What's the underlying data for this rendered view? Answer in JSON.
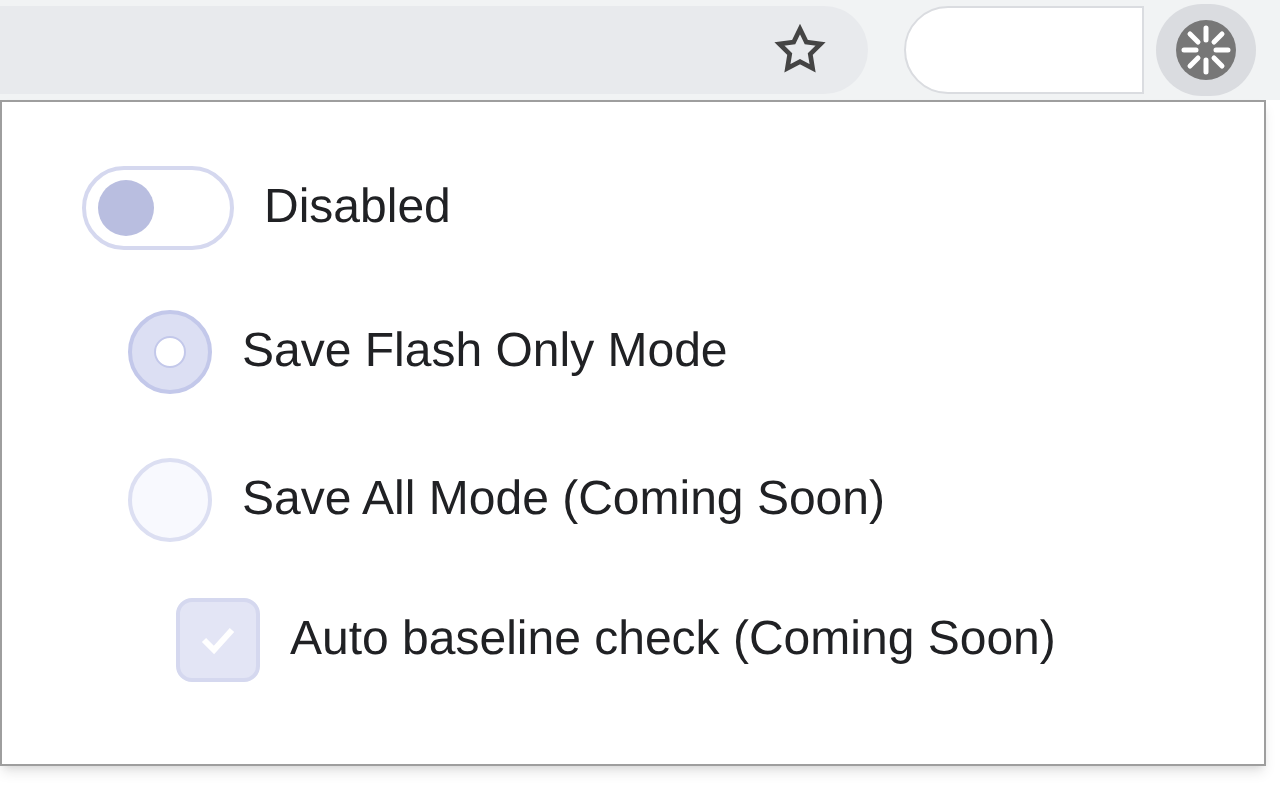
{
  "toggle": {
    "label": "Disabled",
    "on": false
  },
  "modes": [
    {
      "label": "Save Flash Only Mode",
      "selected": true
    },
    {
      "label": "Save All Mode (Coming Soon)",
      "selected": false
    }
  ],
  "option": {
    "label": "Auto baseline check (Coming Soon)",
    "checked": true
  }
}
